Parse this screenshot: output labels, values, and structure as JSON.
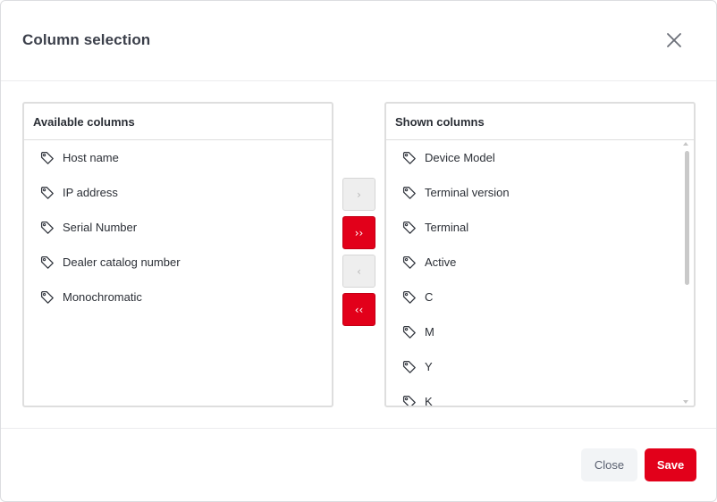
{
  "dialog": {
    "title": "Column selection",
    "close_icon": "close-icon"
  },
  "available": {
    "header": "Available columns",
    "items": [
      {
        "label": "Host name"
      },
      {
        "label": "IP address"
      },
      {
        "label": "Serial Number"
      },
      {
        "label": "Dealer catalog number"
      },
      {
        "label": "Monochromatic"
      }
    ]
  },
  "shown": {
    "header": "Shown columns",
    "items": [
      {
        "label": "Device Model"
      },
      {
        "label": "Terminal version"
      },
      {
        "label": "Terminal"
      },
      {
        "label": "Active"
      },
      {
        "label": "C"
      },
      {
        "label": "M"
      },
      {
        "label": "Y"
      },
      {
        "label": "K"
      }
    ]
  },
  "transfer": {
    "move_right": {
      "glyph": "›",
      "enabled": false
    },
    "move_all_right": {
      "glyph": "››",
      "enabled": true
    },
    "move_left": {
      "glyph": "‹",
      "enabled": false
    },
    "move_all_left": {
      "glyph": "‹‹",
      "enabled": true
    }
  },
  "footer": {
    "close_label": "Close",
    "save_label": "Save"
  },
  "colors": {
    "accent": "#e2001a",
    "title": "#3b3f4a"
  },
  "icons": {
    "item_icon": "tag-icon"
  }
}
